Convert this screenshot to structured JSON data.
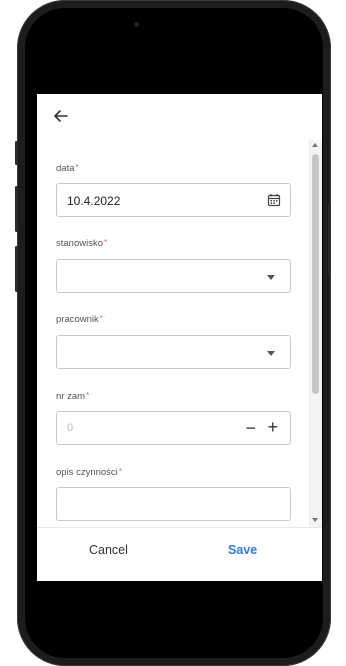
{
  "form": {
    "fields": [
      {
        "label": "data",
        "required_mark": "*",
        "value": "10.4.2022",
        "type": "date"
      },
      {
        "label": "stanowisko",
        "required_mark": "*",
        "value": "",
        "type": "select"
      },
      {
        "label": "pracownik",
        "required_mark": "*",
        "value": "",
        "type": "select"
      },
      {
        "label": "nr zam",
        "required_mark": "*",
        "value": "",
        "placeholder": "0",
        "type": "stepper"
      },
      {
        "label": "opis czynności",
        "required_mark": "*",
        "value": "",
        "type": "textarea"
      }
    ]
  },
  "stepper": {
    "minus": "−",
    "plus": "+"
  },
  "footer": {
    "cancel_label": "Cancel",
    "save_label": "Save"
  },
  "colors": {
    "accent": "#2b7de0",
    "required": "#ff5b5b"
  },
  "icons": {
    "back": "arrow-left-icon",
    "date": "calendar-icon",
    "select": "chevron-down-icon"
  }
}
